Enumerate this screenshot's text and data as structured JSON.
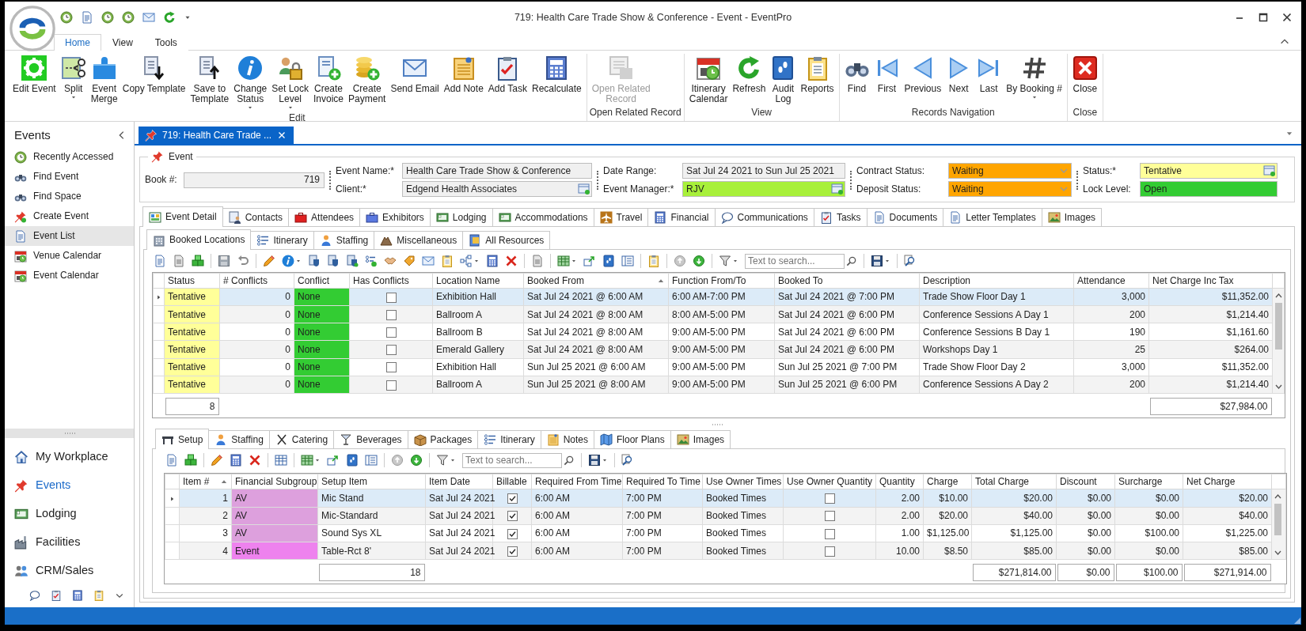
{
  "window": {
    "title": "719: Health Care Trade Show & Conference - Event - EventPro"
  },
  "ribbon_tabs": [
    {
      "label": "Home",
      "selected": true
    },
    {
      "label": "View",
      "selected": false
    },
    {
      "label": "Tools",
      "selected": false
    }
  ],
  "ribbon_groups": [
    {
      "label": "Edit",
      "buttons": [
        {
          "label": "Edit Event"
        },
        {
          "label": "Split",
          "dropdown": true
        },
        {
          "label": "Event\nMerge"
        },
        {
          "label": "Copy Template"
        },
        {
          "label": "Save to\nTemplate"
        },
        {
          "label": "Change\nStatus",
          "dropdown": true
        },
        {
          "label": "Set Lock\nLevel",
          "dropdown": true
        },
        {
          "label": "Create\nInvoice"
        },
        {
          "label": "Create\nPayment"
        },
        {
          "label": "Send Email"
        },
        {
          "label": "Add Note"
        },
        {
          "label": "Add Task"
        },
        {
          "label": "Recalculate"
        }
      ]
    },
    {
      "label": "Open Related Record",
      "buttons": [
        {
          "label": "Open Related\nRecord",
          "disabled": true
        }
      ]
    },
    {
      "label": "View",
      "buttons": [
        {
          "label": "Itinerary\nCalendar"
        },
        {
          "label": "Refresh"
        },
        {
          "label": "Audit\nLog"
        },
        {
          "label": "Reports"
        }
      ]
    },
    {
      "label": "Records Navigation",
      "buttons": [
        {
          "label": "Find"
        },
        {
          "label": "First"
        },
        {
          "label": "Previous"
        },
        {
          "label": "Next"
        },
        {
          "label": "Last"
        },
        {
          "label": "By Booking #",
          "dropdown": true
        }
      ]
    },
    {
      "label": "Close",
      "buttons": [
        {
          "label": "Close"
        }
      ]
    }
  ],
  "sidebar": {
    "title": "Events",
    "items": [
      {
        "label": "Recently Accessed",
        "selected": false
      },
      {
        "label": "Find Event",
        "selected": false
      },
      {
        "label": "Find Space",
        "selected": false
      },
      {
        "label": "Create Event",
        "selected": false
      },
      {
        "label": "Event List",
        "selected": true
      },
      {
        "label": "Venue Calendar",
        "selected": false
      },
      {
        "label": "Event Calendar",
        "selected": false
      }
    ],
    "nav": [
      {
        "label": "My Workplace",
        "selected": false
      },
      {
        "label": "Events",
        "selected": true
      },
      {
        "label": "Lodging",
        "selected": false
      },
      {
        "label": "Facilities",
        "selected": false
      },
      {
        "label": "CRM/Sales",
        "selected": false
      }
    ]
  },
  "document_tab": {
    "label": "719: Health Care Trade ..."
  },
  "event_group": {
    "title": "Event",
    "sections": [
      {
        "fields": [
          {
            "label": "Book #:",
            "value": "719",
            "kind": "number"
          }
        ]
      },
      {
        "fields": [
          {
            "label": "Event Name:*",
            "value": "Health Care Trade Show & Conference",
            "kind": "text"
          },
          {
            "label": "Client:*",
            "value": "Edgend Health Associates",
            "kind": "lookup"
          }
        ]
      },
      {
        "fields": [
          {
            "label": "Date Range:",
            "value": "Sat Jul 24 2021 to Sun Jul 25 2021",
            "kind": "text"
          },
          {
            "label": "Event Manager:*",
            "value": "RJV",
            "kind": "lookup",
            "color": "#a8f03a"
          }
        ]
      },
      {
        "fields": [
          {
            "label": "Contract Status:",
            "value": "Waiting",
            "kind": "combo",
            "color": "#ffa500"
          },
          {
            "label": "Deposit Status:",
            "value": "Waiting",
            "kind": "combo",
            "color": "#ffa500"
          }
        ]
      },
      {
        "fields": [
          {
            "label": "Status:*",
            "value": "Tentative",
            "kind": "lookup",
            "color": "#ffff99"
          },
          {
            "label": "Lock Level:",
            "value": "Open",
            "kind": "text",
            "color": "#33cc33"
          }
        ]
      }
    ]
  },
  "main_tabs": [
    {
      "label": "Event Detail",
      "selected": true
    },
    {
      "label": "Contacts",
      "selected": false
    },
    {
      "label": "Attendees",
      "selected": false
    },
    {
      "label": "Exhibitors",
      "selected": false
    },
    {
      "label": "Lodging",
      "selected": false
    },
    {
      "label": "Accommodations",
      "selected": false
    },
    {
      "label": "Travel",
      "selected": false
    },
    {
      "label": "Financial",
      "selected": false
    },
    {
      "label": "Communications",
      "selected": false
    },
    {
      "label": "Tasks",
      "selected": false
    },
    {
      "label": "Documents",
      "selected": false
    },
    {
      "label": "Letter Templates",
      "selected": false
    },
    {
      "label": "Images",
      "selected": false
    }
  ],
  "detail_tabs": [
    {
      "label": "Booked Locations",
      "selected": true
    },
    {
      "label": "Itinerary",
      "selected": false
    },
    {
      "label": "Staffing",
      "selected": false
    },
    {
      "label": "Miscellaneous",
      "selected": false
    },
    {
      "label": "All Resources",
      "selected": false
    }
  ],
  "locations_toolbar": {
    "search_placeholder": "Text to search..."
  },
  "locations_grid": {
    "columns": [
      {
        "label": "Status",
        "kind": "text",
        "total": "8"
      },
      {
        "label": "# Conflicts",
        "kind": "number"
      },
      {
        "label": "Conflict",
        "kind": "text"
      },
      {
        "label": "Has Conflicts",
        "kind": "check"
      },
      {
        "label": "Location Name",
        "kind": "text"
      },
      {
        "label": "Booked From",
        "kind": "text",
        "sorted": true
      },
      {
        "label": "Function From/To",
        "kind": "text"
      },
      {
        "label": "Booked To",
        "kind": "text"
      },
      {
        "label": "Description",
        "kind": "text"
      },
      {
        "label": "Attendance",
        "kind": "number"
      },
      {
        "label": "Net Charge Inc Tax",
        "kind": "number",
        "total": "$27,984.00"
      }
    ],
    "rows": [
      {
        "selected": true,
        "cells": [
          {
            "text": "Tentative",
            "color": "#ffff99"
          },
          "0",
          {
            "text": "None",
            "color": "#33cc33"
          },
          false,
          "Exhibition Hall",
          "Sat Jul 24 2021 @ 6:00 AM",
          "6:00 AM-7:00 PM",
          "Sat Jul 24 2021 @ 7:00 PM",
          "Trade Show Floor Day 1",
          "3,000",
          "$11,352.00"
        ]
      },
      {
        "selected": false,
        "cells": [
          {
            "text": "Tentative",
            "color": "#ffff99"
          },
          "0",
          {
            "text": "None",
            "color": "#33cc33"
          },
          false,
          "Ballroom A",
          "Sat Jul 24 2021 @ 8:00 AM",
          "8:00 AM-5:00 PM",
          "Sat Jul 24 2021 @ 6:00 PM",
          "Conference Sessions A Day 1",
          "200",
          "$1,214.40"
        ]
      },
      {
        "selected": false,
        "cells": [
          {
            "text": "Tentative",
            "color": "#ffff99"
          },
          "0",
          {
            "text": "None",
            "color": "#33cc33"
          },
          false,
          "Ballroom B",
          "Sat Jul 24 2021 @ 8:00 AM",
          "9:00 AM-5:00 PM",
          "Sat Jul 24 2021 @ 6:00 PM",
          "Conference Sessions B Day 1",
          "190",
          "$1,161.60"
        ]
      },
      {
        "selected": false,
        "cells": [
          {
            "text": "Tentative",
            "color": "#ffff99"
          },
          "0",
          {
            "text": "None",
            "color": "#33cc33"
          },
          false,
          "Emerald Gallery",
          "Sat Jul 24 2021 @ 8:00 AM",
          "9:00 AM-5:00 PM",
          "Sat Jul 24 2021 @ 6:00 PM",
          "Workshops Day 1",
          "25",
          "$264.00"
        ]
      },
      {
        "selected": false,
        "cells": [
          {
            "text": "Tentative",
            "color": "#ffff99"
          },
          "0",
          {
            "text": "None",
            "color": "#33cc33"
          },
          false,
          "Exhibition Hall",
          "Sun Jul 25 2021 @ 6:00 AM",
          "9:00 AM-5:00 PM",
          "Sun Jul 25 2021 @ 7:00 PM",
          "Trade Show Floor Day 2",
          "3,000",
          "$11,352.00"
        ]
      },
      {
        "selected": false,
        "cells": [
          {
            "text": "Tentative",
            "color": "#ffff99"
          },
          "0",
          {
            "text": "None",
            "color": "#33cc33"
          },
          false,
          "Ballroom A",
          "Sun Jul 25 2021 @ 8:00 AM",
          "9:00 AM-5:00 PM",
          "Sun Jul 25 2021 @ 6:00 PM",
          "Conference Sessions A Day 2",
          "200",
          "$1,214.40"
        ]
      }
    ]
  },
  "resource_tabs": [
    {
      "label": "Setup",
      "selected": true
    },
    {
      "label": "Staffing",
      "selected": false
    },
    {
      "label": "Catering",
      "selected": false
    },
    {
      "label": "Beverages",
      "selected": false
    },
    {
      "label": "Packages",
      "selected": false
    },
    {
      "label": "Itinerary",
      "selected": false
    },
    {
      "label": "Notes",
      "selected": false
    },
    {
      "label": "Floor Plans",
      "selected": false
    },
    {
      "label": "Images",
      "selected": false
    }
  ],
  "setup_toolbar": {
    "search_placeholder": "Text to search..."
  },
  "setup_grid": {
    "columns": [
      {
        "label": "Item #",
        "kind": "number",
        "sorted": true
      },
      {
        "label": "Financial Subgroup",
        "kind": "text"
      },
      {
        "label": "Setup Item",
        "kind": "text",
        "total": "18"
      },
      {
        "label": "Item Date",
        "kind": "text"
      },
      {
        "label": "Billable",
        "kind": "check"
      },
      {
        "label": "Required From Time",
        "kind": "text"
      },
      {
        "label": "Required To Time",
        "kind": "text"
      },
      {
        "label": "Use Owner Times",
        "kind": "text"
      },
      {
        "label": "Use Owner Quantity",
        "kind": "check"
      },
      {
        "label": "Quantity",
        "kind": "number"
      },
      {
        "label": "Charge",
        "kind": "number"
      },
      {
        "label": "Total Charge",
        "kind": "number",
        "total": "$271,814.00"
      },
      {
        "label": "Discount",
        "kind": "number",
        "total": "$0.00"
      },
      {
        "label": "Surcharge",
        "kind": "number",
        "total": "$100.00"
      },
      {
        "label": "Net Charge",
        "kind": "number",
        "total": "$271,914.00"
      }
    ],
    "rows": [
      {
        "selected": true,
        "cells": [
          "1",
          {
            "text": "AV",
            "color": "#dda0dd"
          },
          "Mic Stand",
          "Sat Jul 24 2021",
          true,
          "6:00 AM",
          "7:00 PM",
          "Booked Times",
          false,
          "2.00",
          "$10.00",
          "$20.00",
          "$0.00",
          "$0.00",
          "$20.00"
        ]
      },
      {
        "selected": false,
        "cells": [
          "2",
          {
            "text": "AV",
            "color": "#dda0dd"
          },
          "Mic-Standard",
          "Sat Jul 24 2021",
          true,
          "6:00 AM",
          "7:00 PM",
          "Booked Times",
          false,
          "2.00",
          "$20.00",
          "$40.00",
          "$0.00",
          "$0.00",
          "$40.00"
        ]
      },
      {
        "selected": false,
        "cells": [
          "3",
          {
            "text": "AV",
            "color": "#dda0dd"
          },
          "Sound Sys XL",
          "Sat Jul 24 2021",
          true,
          "6:00 AM",
          "7:00 PM",
          "Booked Times",
          false,
          "1.00",
          "$1,125.00",
          "$1,125.00",
          "$0.00",
          "$100.00",
          "$1,225.00"
        ]
      },
      {
        "selected": false,
        "cells": [
          "4",
          {
            "text": "Event",
            "color": "#ee82ee"
          },
          "Table-Rct 8'",
          "Sat Jul 24 2021",
          true,
          "6:00 AM",
          "7:00 PM",
          "Booked Times",
          false,
          "10.00",
          "$8.50",
          "$85.00",
          "$0.00",
          "$0.00",
          "$85.00"
        ]
      }
    ]
  }
}
